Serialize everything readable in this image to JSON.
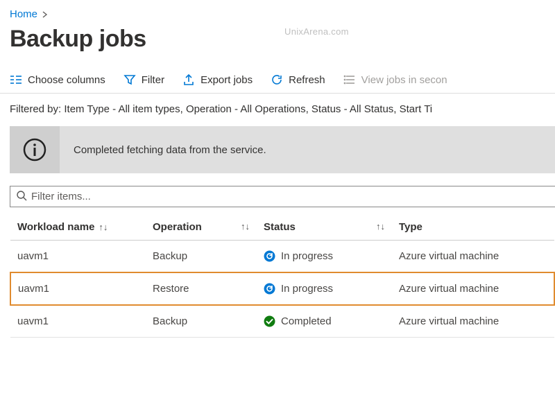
{
  "breadcrumb": {
    "home": "Home"
  },
  "watermark": "UnixArena.com",
  "page_title": "Backup jobs",
  "toolbar": {
    "choose_columns": "Choose columns",
    "filter": "Filter",
    "export": "Export jobs",
    "refresh": "Refresh",
    "view_secondary": "View jobs in secon"
  },
  "filter_summary": "Filtered by: Item Type - All item types, Operation - All Operations, Status - All Status, Start Ti",
  "info_message": "Completed fetching data from the service.",
  "search": {
    "placeholder": "Filter items..."
  },
  "columns": {
    "workload": "Workload name",
    "operation": "Operation",
    "status": "Status",
    "type": "Type"
  },
  "rows": [
    {
      "workload": "uavm1",
      "operation": "Backup",
      "status_icon": "progress",
      "status": "In progress",
      "type": "Azure virtual machine",
      "highlight": false
    },
    {
      "workload": "uavm1",
      "operation": "Restore",
      "status_icon": "progress",
      "status": "In progress",
      "type": "Azure virtual machine",
      "highlight": true
    },
    {
      "workload": "uavm1",
      "operation": "Backup",
      "status_icon": "success",
      "status": "Completed",
      "type": "Azure virtual machine",
      "highlight": false
    }
  ]
}
